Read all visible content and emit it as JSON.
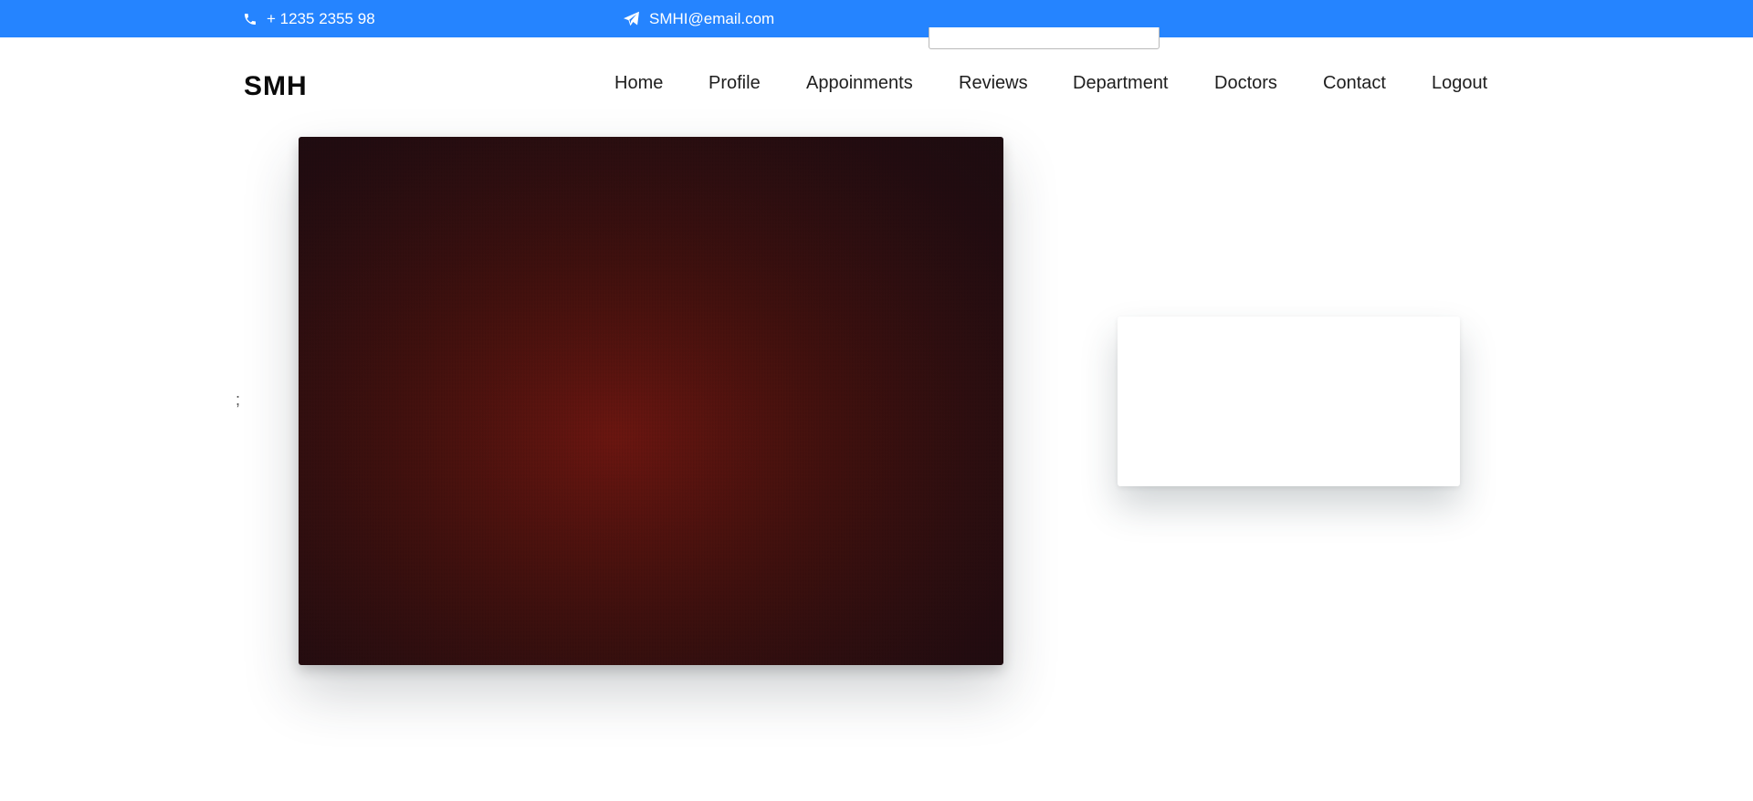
{
  "topbar": {
    "phone": "+ 1235 2355 98",
    "email": "SMHI@email.com",
    "phone_icon": "phone-icon",
    "email_icon": "paper-plane-icon",
    "background_color": "#2584ff"
  },
  "brand": {
    "name": "SMH"
  },
  "nav": {
    "items": [
      {
        "label": "Home"
      },
      {
        "label": "Profile"
      },
      {
        "label": "Appoinments"
      },
      {
        "label": "Reviews"
      },
      {
        "label": "Department"
      },
      {
        "label": "Doctors"
      },
      {
        "label": "Contact"
      },
      {
        "label": "Logout"
      }
    ]
  },
  "misc": {
    "stray_text": ";"
  },
  "colors": {
    "hero_image_tone": "#5a1510"
  }
}
